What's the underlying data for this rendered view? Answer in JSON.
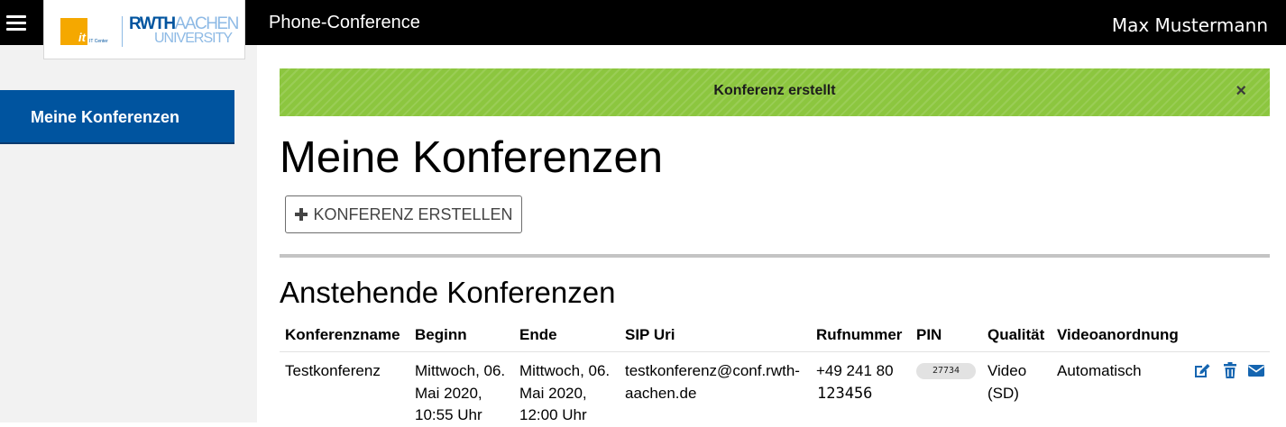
{
  "header": {
    "logo": {
      "it_letters": "it",
      "it_center": "IT Center",
      "rwth_line1_bold": "RWTH",
      "rwth_line1_light": "AACHEN",
      "rwth_line2": "UNIVERSITY"
    },
    "app_title": "Phone-Conference",
    "user_name": "Max Mustermann"
  },
  "sidebar": {
    "items": [
      {
        "label": "Meine Konferenzen",
        "active": true
      }
    ]
  },
  "alert": {
    "message": "Konferenz erstellt",
    "close_symbol": "×",
    "color": "#8cc63f"
  },
  "main": {
    "title": "Meine Konferenzen",
    "create_button": {
      "icon": "plus-icon",
      "label": "KONFERENZ ERSTELLEN"
    },
    "section_title": "Anstehende Konferenzen",
    "table": {
      "headers": [
        "Konferenzname",
        "Beginn",
        "Ende",
        "SIP Uri",
        "Rufnummer",
        "PIN",
        "Qualität",
        "Videoanordnung"
      ],
      "rows": [
        {
          "name": "Testkonferenz",
          "begin": [
            "Mittwoch, 06.",
            "Mai 2020,",
            "10:55 Uhr"
          ],
          "end": [
            "Mittwoch, 06.",
            "Mai 2020,",
            "12:00 Uhr"
          ],
          "sip_uri": [
            "testkonferenz@conf.rwth-",
            "aachen.de"
          ],
          "phone": [
            "+49 241 80",
            "123456"
          ],
          "pin": "27734",
          "quality": [
            "Video",
            "(SD)"
          ],
          "layout": "Automatisch",
          "actions": [
            "edit-icon",
            "trash-icon",
            "envelope-icon"
          ]
        }
      ]
    }
  },
  "colors": {
    "brand_blue": "#00549f",
    "light_blue": "#8ebae5",
    "orange": "#f5a800",
    "action_blue": "#1565b0"
  }
}
